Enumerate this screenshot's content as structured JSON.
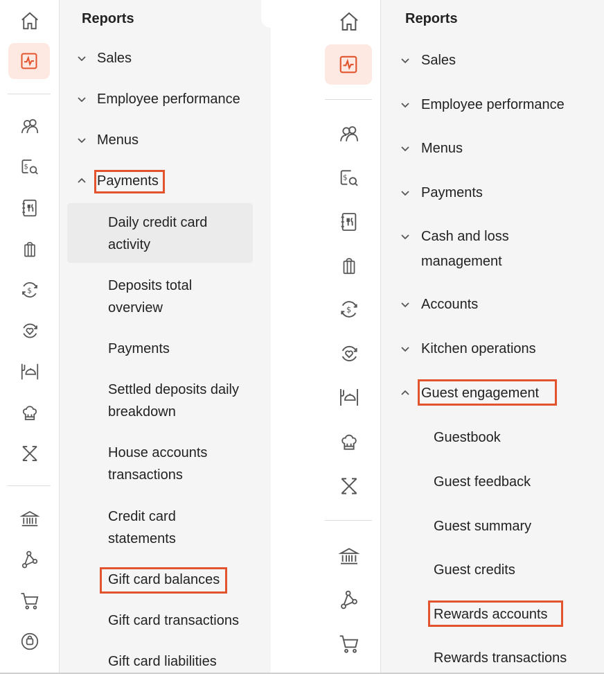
{
  "left": {
    "heading": "Reports",
    "sections": [
      {
        "label": "Sales",
        "expanded": false
      },
      {
        "label": "Employee performance",
        "expanded": false
      },
      {
        "label": "Menus",
        "expanded": false
      },
      {
        "label": "Payments",
        "expanded": true,
        "highlighted": true
      }
    ],
    "items": [
      {
        "line1": "Daily credit card",
        "line2": "activity",
        "selected": true
      },
      {
        "line1": "Deposits total",
        "line2": "overview"
      },
      {
        "line1": "Payments",
        "line2": ""
      },
      {
        "line1": "Settled deposits daily",
        "line2": "breakdown"
      },
      {
        "line1": "House accounts",
        "line2": "transactions"
      },
      {
        "line1": "Credit card",
        "line2": "statements"
      },
      {
        "line1": "Gift card balances",
        "line2": "",
        "highlighted": true
      },
      {
        "line1": "Gift card transactions",
        "line2": ""
      },
      {
        "line1": "Gift card liabilities",
        "line2": ""
      }
    ]
  },
  "right": {
    "heading": "Reports",
    "sections": [
      {
        "label": "Sales",
        "line2": "",
        "expanded": false
      },
      {
        "label": "Employee performance",
        "line2": "",
        "expanded": false
      },
      {
        "label": "Menus",
        "line2": "",
        "expanded": false
      },
      {
        "label": "Payments",
        "line2": "",
        "expanded": false
      },
      {
        "label": "Cash and loss",
        "line2": "management",
        "expanded": false
      },
      {
        "label": "Accounts",
        "line2": "",
        "expanded": false
      },
      {
        "label": "Kitchen operations",
        "line2": "",
        "expanded": false
      },
      {
        "label": "Guest engagement",
        "line2": "",
        "expanded": true,
        "highlighted": true
      }
    ],
    "items": [
      {
        "label": "Guestbook"
      },
      {
        "label": "Guest feedback"
      },
      {
        "label": "Guest summary"
      },
      {
        "label": "Guest credits"
      },
      {
        "label": "Rewards accounts",
        "highlighted": true
      },
      {
        "label": "Rewards transactions"
      }
    ]
  },
  "rail_icons": [
    "home-icon",
    "reports-icon",
    "guests-icon",
    "payroll-icon",
    "menu-icon",
    "gift-card-icon",
    "refund-icon",
    "loyalty-icon",
    "dining-icon",
    "kitchen-icon",
    "integrations-icon",
    "bank-icon",
    "network-icon",
    "cart-icon",
    "support-icon"
  ],
  "colors": {
    "accent": "#e2542e",
    "active_bg": "#fde8e2",
    "menu_bg": "#f5f5f5",
    "selected_bg": "#ebebeb"
  }
}
